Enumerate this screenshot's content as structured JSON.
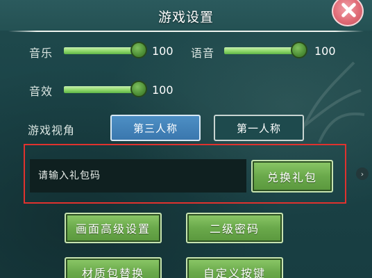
{
  "title": "游戏设置",
  "close_icon": "close-x-icon",
  "audio": {
    "music": {
      "label": "音乐",
      "value": "100",
      "level": 1.0
    },
    "voice": {
      "label": "语音",
      "value": "100",
      "level": 1.0
    },
    "sfx": {
      "label": "音效",
      "value": "100",
      "level": 1.0
    }
  },
  "view": {
    "label": "游戏视角",
    "options": [
      "第三人称",
      "第一人称"
    ],
    "selected": "第三人称"
  },
  "gift": {
    "placeholder": "请输入礼包码",
    "redeem_label": "兑换礼包"
  },
  "buttons": {
    "advanced_graphics": "画面高级设置",
    "second_password": "二级密码",
    "texture_pack": "材质包替换",
    "custom_keys": "自定义按键"
  },
  "colors": {
    "accent_green": "#6aa94b",
    "selected_blue": "#3a77ae",
    "highlight_red": "#e0322e",
    "close_pink": "#e06b76"
  }
}
